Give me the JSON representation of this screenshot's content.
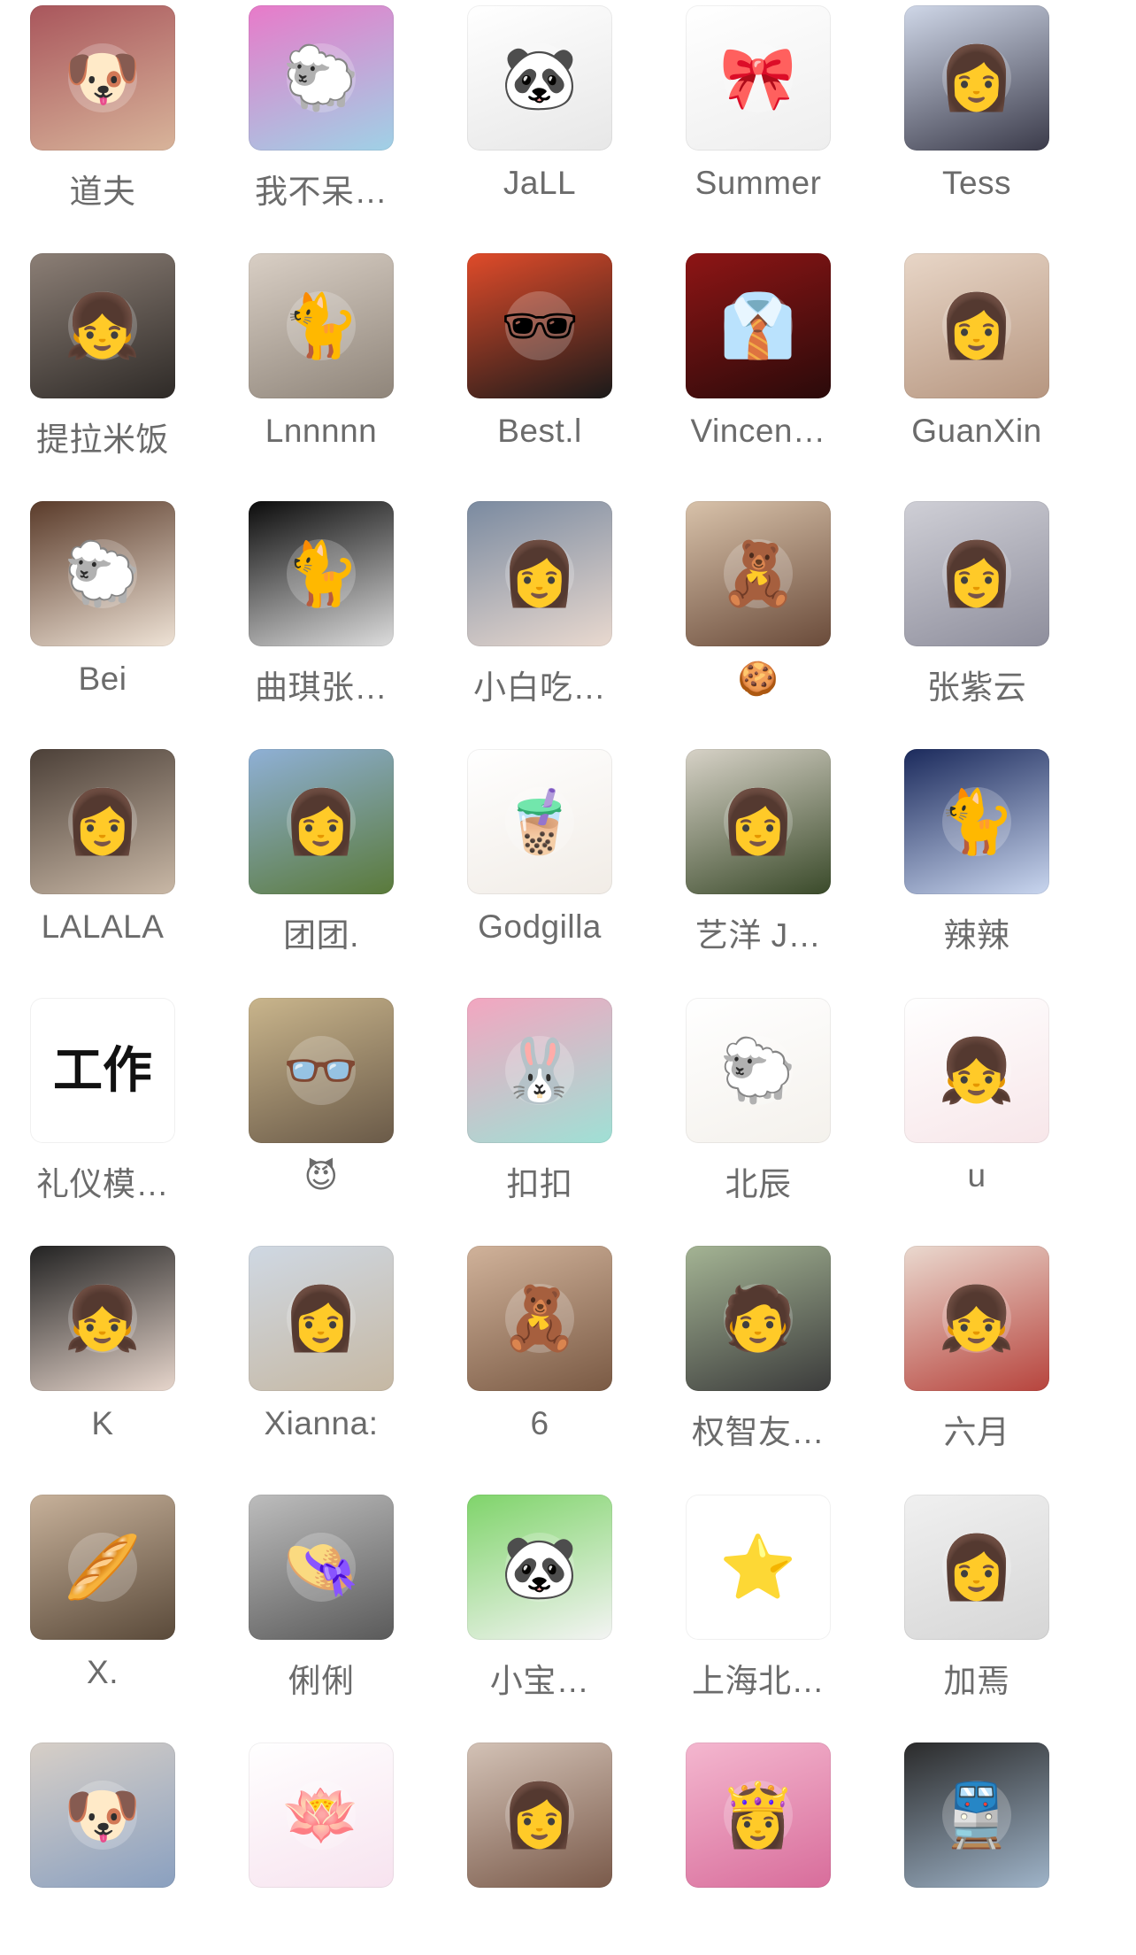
{
  "contacts": [
    {
      "name": "道夫",
      "icon": "dog-avatar",
      "glyph": "🐶",
      "bg": [
        "#a9565c",
        "#d8b49a"
      ]
    },
    {
      "name": "我不呆…",
      "icon": "cartoon-lamb-avatar",
      "glyph": "🐑",
      "bg": [
        "#e87ac9",
        "#9fd1e6"
      ]
    },
    {
      "name": "JaLL",
      "icon": "panda-sunglasses-avatar",
      "glyph": "🐼",
      "bg": [
        "#ffffff",
        "#e7e7e7"
      ]
    },
    {
      "name": "Summer",
      "icon": "hello-kitty-avatar",
      "glyph": "🎀",
      "bg": [
        "#ffffff",
        "#eeeeee"
      ]
    },
    {
      "name": "Tess",
      "icon": "illustrated-girl-avatar",
      "glyph": "👩",
      "bg": [
        "#cfd7e8",
        "#3b3b4a"
      ]
    },
    {
      "name": "提拉米饭",
      "icon": "selfie-girl-avatar",
      "glyph": "👧",
      "bg": [
        "#8c7f76",
        "#2e2a27"
      ]
    },
    {
      "name": "Lnnnnn",
      "icon": "black-cat-avatar",
      "glyph": "🐈",
      "bg": [
        "#d9cfc5",
        "#8f857a"
      ]
    },
    {
      "name": "Best.l",
      "icon": "manga-character-avatar",
      "glyph": "🕶",
      "bg": [
        "#e04b2a",
        "#1a1a1a"
      ]
    },
    {
      "name": "Vincen…",
      "icon": "man-red-suit-avatar",
      "glyph": "👔",
      "bg": [
        "#8e1515",
        "#2a0a0a"
      ]
    },
    {
      "name": "GuanXin",
      "icon": "portrait-girl-avatar",
      "glyph": "👩",
      "bg": [
        "#e8d6c7",
        "#b69680"
      ]
    },
    {
      "name": "Bei",
      "icon": "plush-sheep-avatar",
      "glyph": "🐑",
      "bg": [
        "#5a3b2a",
        "#efe3d6"
      ]
    },
    {
      "name": "曲琪张…",
      "icon": "black-cat-snow-avatar",
      "glyph": "🐈",
      "bg": [
        "#0b0b0b",
        "#dddddd"
      ]
    },
    {
      "name": "小白吃…",
      "icon": "car-selfie-avatar",
      "glyph": "👩",
      "bg": [
        "#7a8aa0",
        "#e9d9cf"
      ]
    },
    {
      "name": "🍪",
      "icon": "girl-with-bear-avatar",
      "glyph": "🧸",
      "bg": [
        "#d8c2aa",
        "#6a4b3a"
      ]
    },
    {
      "name": "张紫云",
      "icon": "girl-in-bed-avatar",
      "glyph": "👩",
      "bg": [
        "#cfcfd6",
        "#8e8e9c"
      ]
    },
    {
      "name": "LALALA",
      "icon": "girl-black-dress-avatar",
      "glyph": "👩",
      "bg": [
        "#4c4038",
        "#c9b8a6"
      ]
    },
    {
      "name": "团团.",
      "icon": "girl-outdoors-avatar",
      "glyph": "👩",
      "bg": [
        "#8fb0d6",
        "#5a7a3a"
      ]
    },
    {
      "name": "Godgilla",
      "icon": "cat-bubble-tea-avatar",
      "glyph": "🧋",
      "bg": [
        "#ffffff",
        "#f1ece6"
      ]
    },
    {
      "name": "艺洋 J…",
      "icon": "elegant-girl-avatar",
      "glyph": "👩",
      "bg": [
        "#d7d2c7",
        "#3a4a2a"
      ]
    },
    {
      "name": "辣辣",
      "icon": "white-cat-snow-avatar",
      "glyph": "🐈",
      "bg": [
        "#1b2a5c",
        "#c9d6ef"
      ]
    },
    {
      "name": "礼仪模…",
      "icon": "text-work-avatar",
      "glyph": "工作",
      "bg": [
        "#ffffff",
        "#ffffff"
      ]
    },
    {
      "name": "😈",
      "icon": "blonde-girl-glasses-avatar",
      "glyph": "👓",
      "bg": [
        "#c9b58c",
        "#6a5a48"
      ]
    },
    {
      "name": "扣扣",
      "icon": "cartoon-stickers-avatar",
      "glyph": "🐰",
      "bg": [
        "#f3a6c0",
        "#9fe0d5"
      ]
    },
    {
      "name": "北辰",
      "icon": "fluffy-lambs-avatar",
      "glyph": "🐑",
      "bg": [
        "#ffffff",
        "#f4f1ec"
      ]
    },
    {
      "name": "u",
      "icon": "cartoon-girl-avatar",
      "glyph": "👧",
      "bg": [
        "#ffffff",
        "#f7e6e9"
      ]
    },
    {
      "name": "K",
      "icon": "bangs-girl-avatar",
      "glyph": "👧",
      "bg": [
        "#222222",
        "#e7d6cc"
      ]
    },
    {
      "name": "Xianna:",
      "icon": "girl-beach-avatar",
      "glyph": "👩",
      "bg": [
        "#cfd8e3",
        "#c6b8a3"
      ]
    },
    {
      "name": "6",
      "icon": "boy-plush-avatar",
      "glyph": "🧸",
      "bg": [
        "#d0b29a",
        "#7a5a44"
      ]
    },
    {
      "name": "权智友…",
      "icon": "man-sitting-avatar",
      "glyph": "🧑",
      "bg": [
        "#a4b494",
        "#3b3b3b"
      ]
    },
    {
      "name": "六月",
      "icon": "crying-girl-avatar",
      "glyph": "👧",
      "bg": [
        "#ead9cf",
        "#b7443d"
      ]
    },
    {
      "name": "X.",
      "icon": "girl-with-bread-avatar",
      "glyph": "🥖",
      "bg": [
        "#c7b19a",
        "#5a4a3a"
      ]
    },
    {
      "name": "俐俐",
      "icon": "girl-hat-avatar",
      "glyph": "👒",
      "bg": [
        "#bdbdbd",
        "#5a5a5a"
      ]
    },
    {
      "name": "小宝…",
      "icon": "panda-cartoon-avatar",
      "glyph": "🐼",
      "bg": [
        "#7fd46a",
        "#f4f4f4"
      ]
    },
    {
      "name": "上海北…",
      "icon": "beidouxing-logo-avatar",
      "glyph": "⭐",
      "bg": [
        "#ffffff",
        "#ffffff"
      ]
    },
    {
      "name": "加焉",
      "icon": "sketch-girl-avatar",
      "glyph": "👩",
      "bg": [
        "#f0f0f0",
        "#d6d6d6"
      ]
    },
    {
      "name": "",
      "icon": "girl-with-dog-avatar",
      "glyph": "🐶",
      "bg": [
        "#d7cfc7",
        "#8aa0c0"
      ]
    },
    {
      "name": "",
      "icon": "hello-kitty-lotus-avatar",
      "glyph": "🪷",
      "bg": [
        "#ffffff",
        "#f7e3ef"
      ]
    },
    {
      "name": "",
      "icon": "girl-selfie-avatar",
      "glyph": "👩",
      "bg": [
        "#d3c2b6",
        "#7a5a4a"
      ]
    },
    {
      "name": "",
      "icon": "barbie-avatar",
      "glyph": "👸",
      "bg": [
        "#f4b7cf",
        "#d86d9b"
      ]
    },
    {
      "name": "",
      "icon": "train-window-avatar",
      "glyph": "🚆",
      "bg": [
        "#2a2a2a",
        "#9fb4c9"
      ]
    }
  ]
}
